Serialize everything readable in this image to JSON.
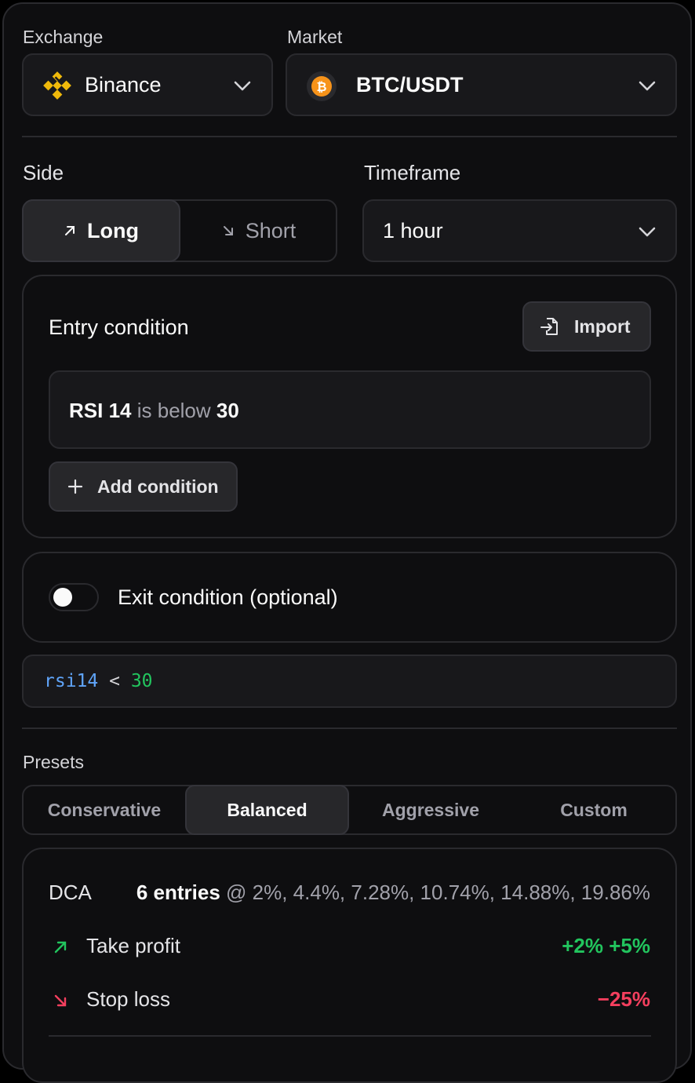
{
  "exchange": {
    "label": "Exchange",
    "value": "Binance",
    "icon": "binance-logo-icon"
  },
  "market": {
    "label": "Market",
    "value": "BTC/USDT",
    "icon": "bitcoin-coin-icon"
  },
  "side": {
    "label": "Side",
    "options": [
      "Long",
      "Short"
    ],
    "selected": "Long"
  },
  "timeframe": {
    "label": "Timeframe",
    "value": "1 hour"
  },
  "entry": {
    "title": "Entry condition",
    "import_label": "Import",
    "condition": {
      "indicator": "RSI 14",
      "operator": "is below",
      "value": "30"
    },
    "add_label": "Add condition"
  },
  "exit": {
    "label": "Exit condition (optional)",
    "enabled": false
  },
  "expression": {
    "ident": "rsi14",
    "op": "<",
    "num": "30"
  },
  "presets": {
    "label": "Presets",
    "options": [
      "Conservative",
      "Balanced",
      "Aggressive",
      "Custom"
    ],
    "selected": "Balanced"
  },
  "summary": {
    "dca_label": "DCA",
    "dca_entries": "6 entries",
    "dca_levels": "@ 2%, 4.4%, 7.28%, 10.74%, 14.88%, 19.86%",
    "tp_label": "Take profit",
    "tp_value": "+2% +5%",
    "sl_label": "Stop loss",
    "sl_value": "−25%"
  },
  "colors": {
    "positive": "#22c55e",
    "negative": "#f43f5e",
    "binance": "#f0b90b",
    "bitcoin": "#f7931a",
    "code_ident": "#60a5fa",
    "code_num": "#22c55e"
  }
}
